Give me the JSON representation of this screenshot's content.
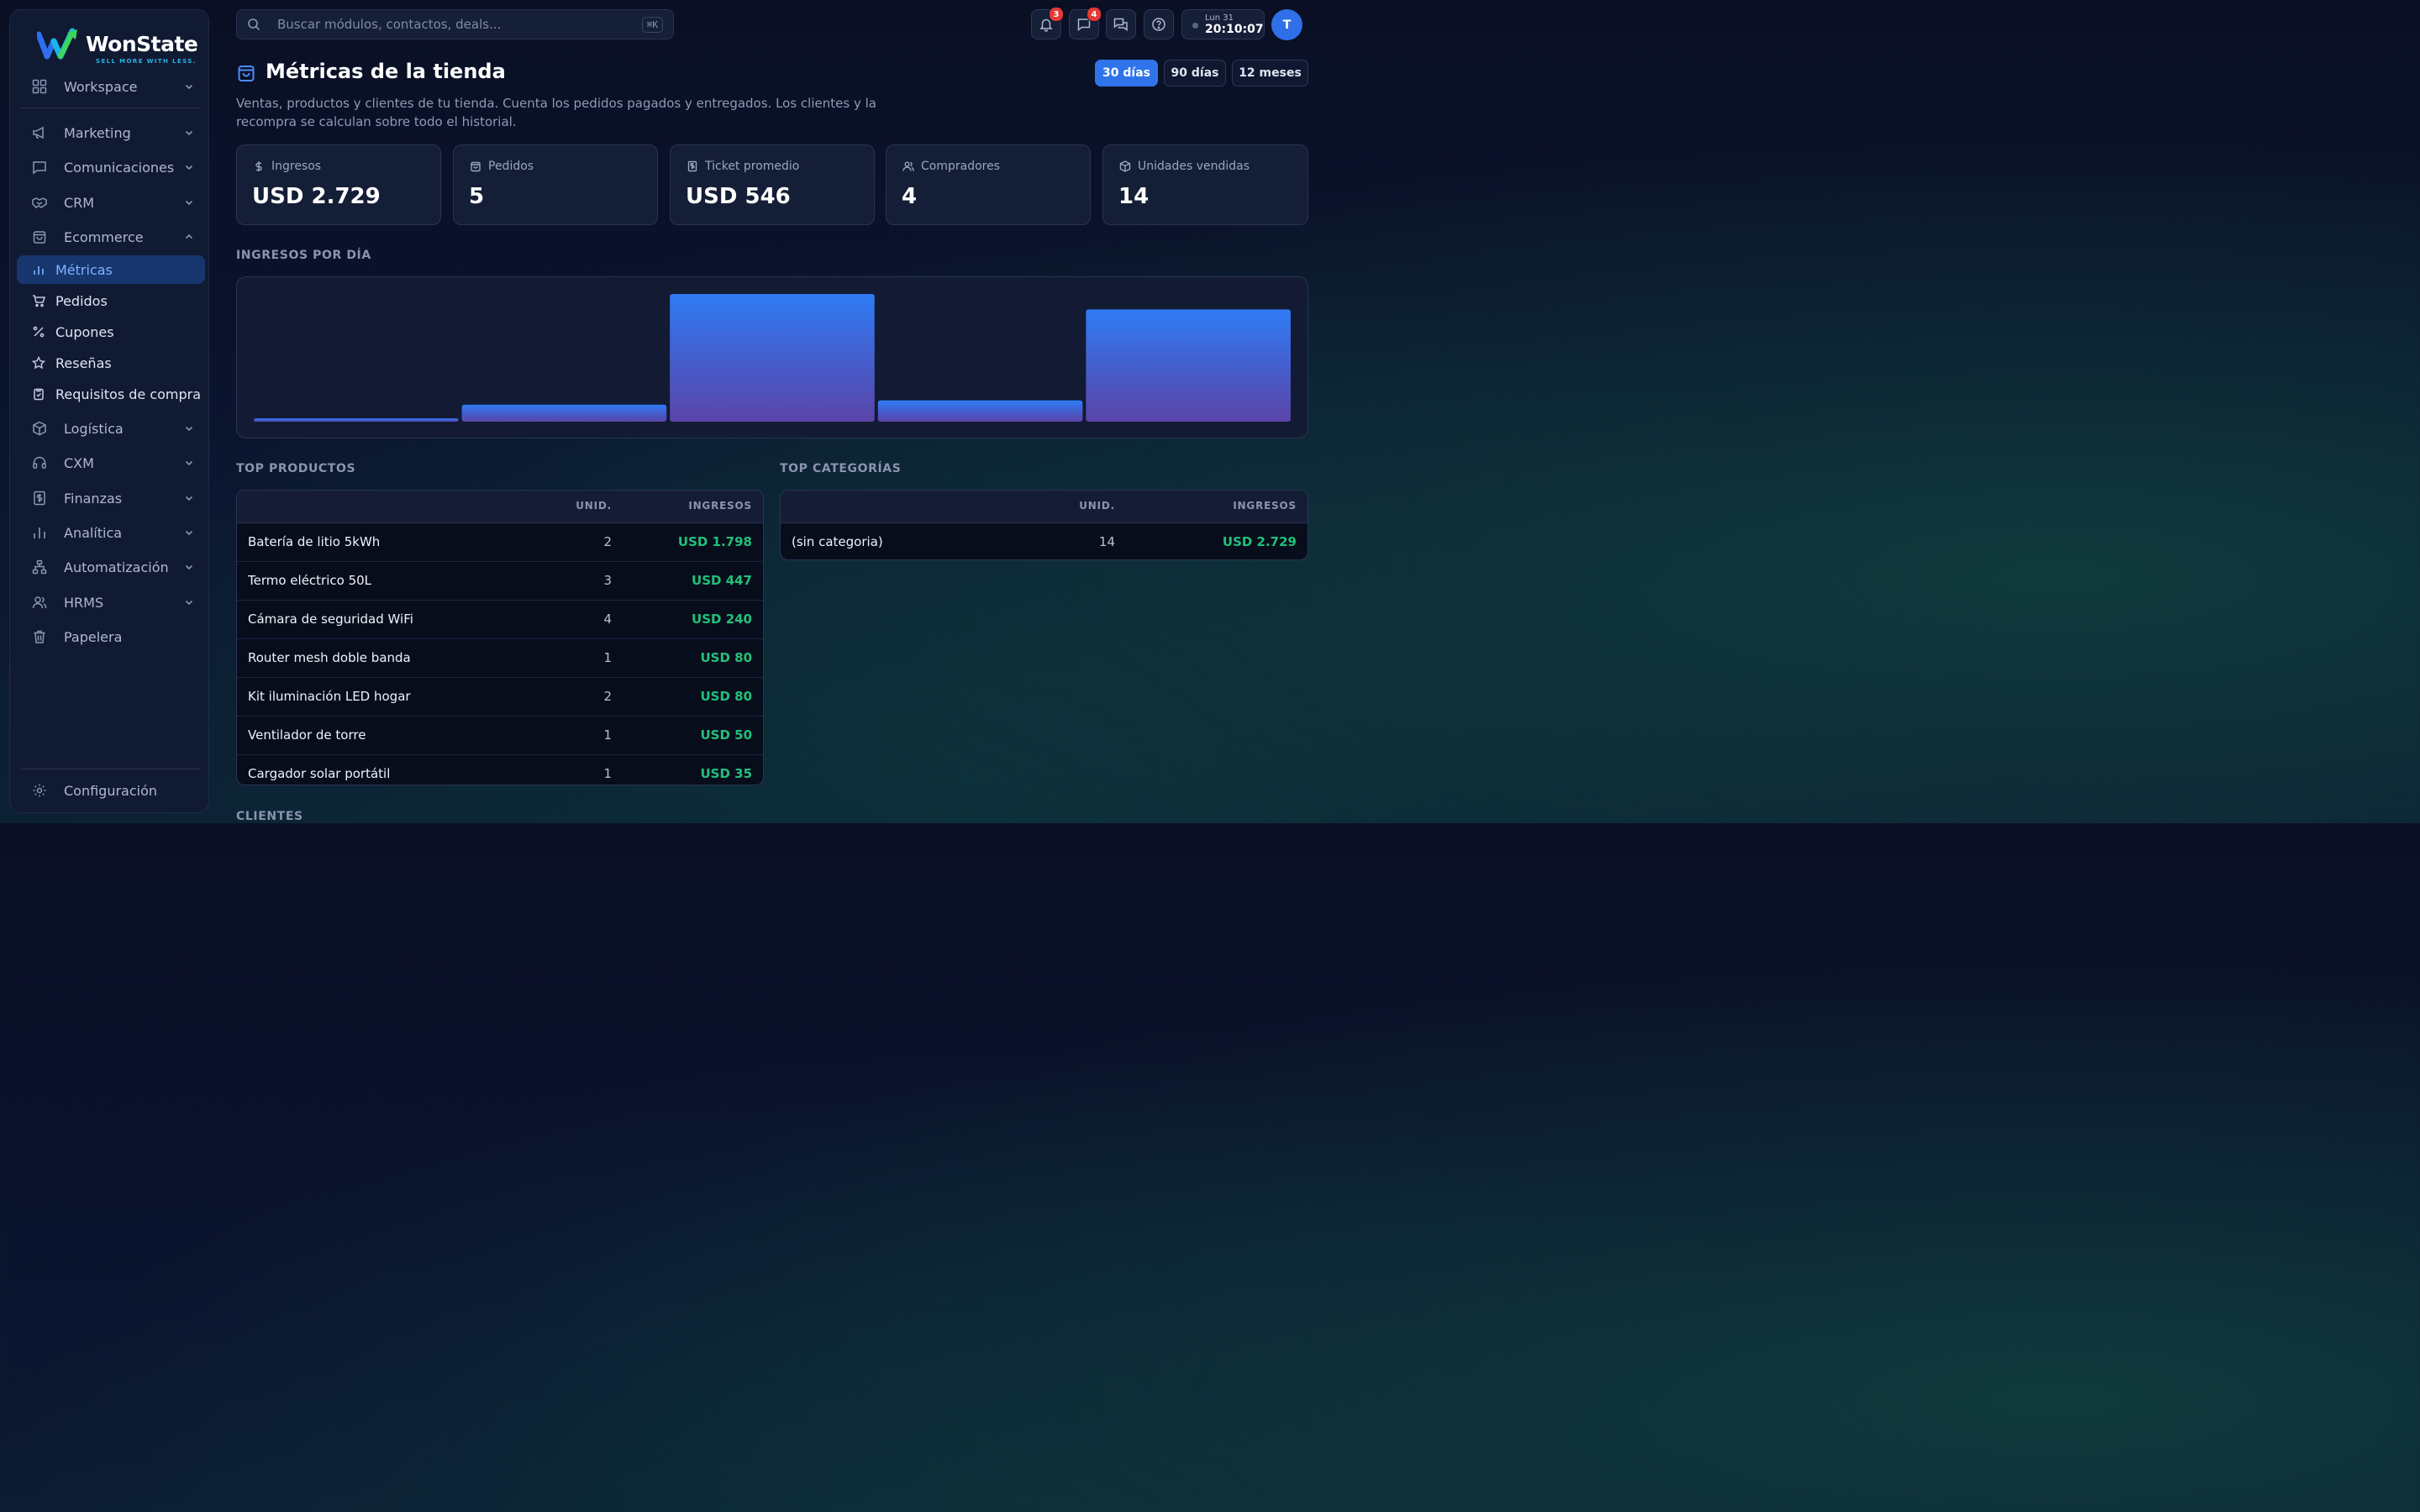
{
  "brand": {
    "name": "WonState",
    "tagline": "SELL MORE WITH LESS."
  },
  "sidebar": {
    "workspace": "Workspace",
    "groups": [
      {
        "label": "Marketing",
        "icon": "megaphone-icon"
      },
      {
        "label": "Comunicaciones",
        "icon": "chat-icon"
      },
      {
        "label": "CRM",
        "icon": "handshake-icon"
      },
      {
        "label": "Ecommerce",
        "icon": "shopping-bag-icon"
      }
    ],
    "ecommerce_items": [
      {
        "label": "Métricas",
        "icon": "bar-chart-icon"
      },
      {
        "label": "Pedidos",
        "icon": "cart-icon"
      },
      {
        "label": "Cupones",
        "icon": "percent-icon"
      },
      {
        "label": "Reseñas",
        "icon": "star-icon"
      },
      {
        "label": "Requisitos de compra",
        "icon": "clipboard-icon"
      }
    ],
    "more_groups": [
      {
        "label": "Logística",
        "icon": "box-icon"
      },
      {
        "label": "CXM",
        "icon": "headset-icon"
      },
      {
        "label": "Finanzas",
        "icon": "dollar-doc-icon"
      },
      {
        "label": "Analítica",
        "icon": "bar-chart-icon"
      },
      {
        "label": "Automatización",
        "icon": "flow-icon"
      },
      {
        "label": "HRMS",
        "icon": "users-icon"
      },
      {
        "label": "Papelera",
        "icon": "trash-icon"
      }
    ],
    "settings": "Configuración"
  },
  "search": {
    "placeholder": "Buscar módulos, contactos, deals...",
    "shortcut": "⌘K"
  },
  "topbar": {
    "notifications_count": "3",
    "messages_count": "4",
    "clock_day": "Lun 31",
    "clock_time": "20:10:07",
    "avatar_initial": "T"
  },
  "page": {
    "title": "Métricas de la tienda",
    "subtitle": "Ventas, productos y clientes de tu tienda. Cuenta los pedidos pagados y entregados. Los clientes y la recompra se calculan sobre todo el historial.",
    "ranges": [
      "30 días",
      "90 días",
      "12 meses"
    ],
    "active_range": "30 días"
  },
  "kpis": [
    {
      "label": "Ingresos",
      "value": "USD 2.729",
      "icon": "dollar-icon"
    },
    {
      "label": "Pedidos",
      "value": "5",
      "icon": "shopping-bag-icon"
    },
    {
      "label": "Ticket promedio",
      "value": "USD 546",
      "icon": "receipt-icon"
    },
    {
      "label": "Compradores",
      "value": "4",
      "icon": "users-icon"
    },
    {
      "label": "Unidades vendidas",
      "value": "14",
      "icon": "box-icon"
    }
  ],
  "sections": {
    "revenue_by_day": "INGRESOS POR DÍA",
    "top_products": "TOP PRODUCTOS",
    "top_categories": "TOP CATEGORÍAS",
    "clients": "CLIENTES"
  },
  "chart_data": {
    "type": "bar",
    "title": "INGRESOS POR DÍA",
    "unit": "USD",
    "categories": [
      "",
      "",
      "",
      "",
      ""
    ],
    "values": [
      35,
      240,
      1798,
      300,
      1580
    ],
    "grid": false,
    "colors": {
      "top": "#2f7bf5",
      "bottom": "#5a44a8"
    }
  },
  "top_products": {
    "headers": {
      "units": "UNID.",
      "revenue": "INGRESOS"
    },
    "rows": [
      {
        "name": "Batería de litio 5kWh",
        "units": "2",
        "revenue": "USD 1.798"
      },
      {
        "name": "Termo eléctrico 50L",
        "units": "3",
        "revenue": "USD 447"
      },
      {
        "name": "Cámara de seguridad WiFi",
        "units": "4",
        "revenue": "USD 240"
      },
      {
        "name": "Router mesh doble banda",
        "units": "1",
        "revenue": "USD 80"
      },
      {
        "name": "Kit iluminación LED hogar",
        "units": "2",
        "revenue": "USD 80"
      },
      {
        "name": "Ventilador de torre",
        "units": "1",
        "revenue": "USD 50"
      },
      {
        "name": "Cargador solar portátil",
        "units": "1",
        "revenue": "USD 35"
      }
    ]
  },
  "top_categories": {
    "headers": {
      "units": "UNID.",
      "revenue": "INGRESOS"
    },
    "rows": [
      {
        "name": "(sin categoria)",
        "units": "14",
        "revenue": "USD 2.729"
      }
    ]
  },
  "colors": {
    "accent": "#2f74ea",
    "positive": "#22c07a",
    "badge": "#e53935"
  }
}
